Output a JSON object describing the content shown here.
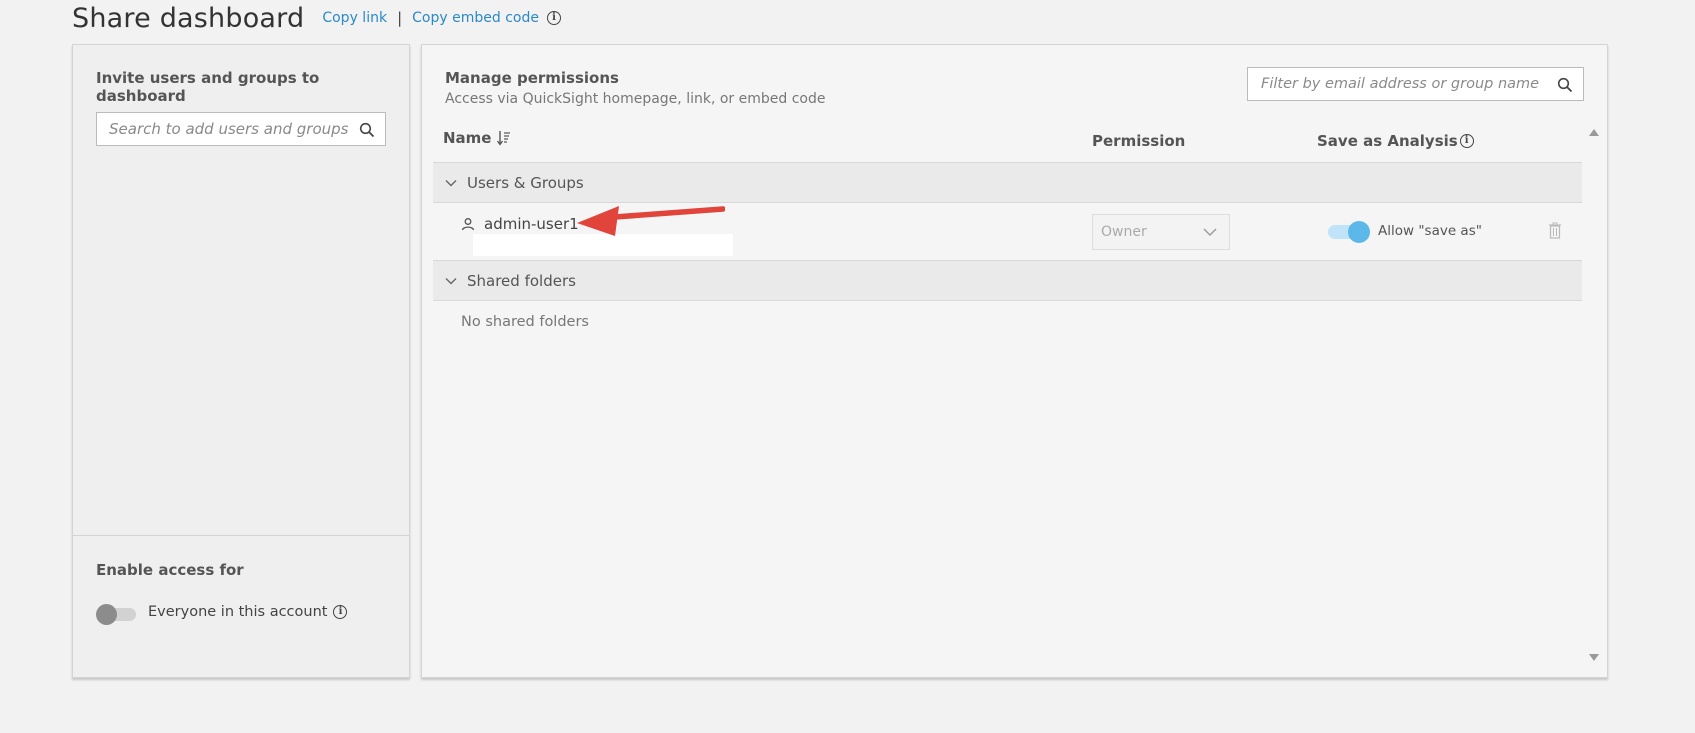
{
  "header": {
    "title": "Share dashboard",
    "copy_link": "Copy link",
    "separator": "|",
    "copy_embed": "Copy embed code"
  },
  "left_panel": {
    "title": "Invite users and groups to dashboard",
    "search_placeholder": "Search to add users and groups",
    "footer_title": "Enable access for",
    "everyone_label": "Everyone in this account",
    "everyone_enabled": false
  },
  "right_panel": {
    "title": "Manage permissions",
    "subtitle": "Access via QuickSight homepage, link, or embed code",
    "filter_placeholder": "Filter by email address or group name",
    "columns": {
      "name": "Name",
      "permission": "Permission",
      "save_as": "Save as Analysis"
    },
    "groups": {
      "users_label": "Users & Groups",
      "folders_label": "Shared folders",
      "no_folders": "No shared folders"
    },
    "user": {
      "name": "admin-user1",
      "permission": "Owner",
      "save_as_label": "Allow \"save as\"",
      "save_as_enabled": true
    }
  },
  "colors": {
    "link": "#2b89c7",
    "toggle_on": "#5bb8e8",
    "annotation_arrow": "#e0443a"
  }
}
